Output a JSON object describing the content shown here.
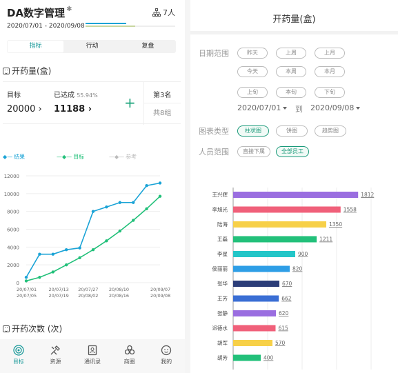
{
  "header": {
    "title": "DA数字管理",
    "people_count": "7人",
    "date_range": "2020/07/01 - 2020/09/08",
    "progress_main": 0.45,
    "progress_sub": 0.55
  },
  "tabs": [
    {
      "label": "指标",
      "active": true
    },
    {
      "label": "行动"
    },
    {
      "label": "复盘"
    }
  ],
  "section1": {
    "title": "开药量(盒)"
  },
  "card": {
    "target_label": "目标",
    "target_value": "20000",
    "achieved_label": "已达成",
    "achieved_pct": "55.94%",
    "achieved_value": "11188",
    "rank": "第3名",
    "group": "共8组"
  },
  "legend": {
    "result": "结果",
    "target": "目标",
    "reference": "参考"
  },
  "colors": {
    "result": "#1aa3d6",
    "target": "#22c07a",
    "reference": "#cccccc",
    "accent": "#1a9a9a"
  },
  "chart_data": [
    {
      "type": "line",
      "y_ticks": [
        "12000",
        "10000",
        "8000",
        "6000",
        "4000",
        "2000",
        "0"
      ],
      "ylim": [
        0,
        12000
      ],
      "x_ticks_top": [
        "20/07/01",
        "20/07/13",
        "20/07/27",
        "20/08/10",
        "20/09/07"
      ],
      "x_ticks_bottom": [
        "20/07/05",
        "20/07/19",
        "20/08/02",
        "20/08/16",
        "20/09/08"
      ],
      "series": [
        {
          "name": "结果",
          "values": [
            600,
            3200,
            3200,
            3700,
            3900,
            8000,
            8500,
            9000,
            9000,
            10900,
            11188
          ]
        },
        {
          "name": "目标",
          "values": [
            200,
            600,
            1200,
            2000,
            2800,
            3700,
            4700,
            5800,
            7000,
            8300,
            9700
          ]
        }
      ]
    },
    {
      "type": "bar",
      "categories": [
        "王兴辉",
        "李旭光",
        "陆海",
        "王磊",
        "李星",
        "侯丽丽",
        "张华",
        "王芳",
        "张静",
        "迟德水",
        "胡军",
        "胡芳"
      ],
      "values": [
        1812,
        1558,
        1350,
        1211,
        900,
        820,
        670,
        662,
        620,
        615,
        570,
        400
      ],
      "colors": [
        "#9a6ee0",
        "#f0607a",
        "#f7d048",
        "#22c07a",
        "#23c6c8",
        "#2e9ee6",
        "#2b3d78",
        "#3a6ed4",
        "#9a6ee0",
        "#f0607a",
        "#f7d048",
        "#22c07a"
      ],
      "xlim": [
        0,
        2000
      ]
    }
  ],
  "section2": {
    "title": "开药次数 (次)"
  },
  "nav": [
    {
      "label": "目标",
      "active": true,
      "icon": "target-icon"
    },
    {
      "label": "资源",
      "icon": "tools-icon"
    },
    {
      "label": "通讯录",
      "icon": "contacts-icon"
    },
    {
      "label": "商圈",
      "icon": "circle-icon"
    },
    {
      "label": "我的",
      "icon": "face-icon"
    }
  ],
  "right": {
    "title": "开药量(盒)",
    "date_label": "日期范围",
    "date_pills": [
      "昨天",
      "上周",
      "上月",
      "今天",
      "本周",
      "本月",
      "上旬",
      "本旬",
      "下旬"
    ],
    "date_start": "2020/07/01",
    "to": "到",
    "date_end": "2020/09/08",
    "chart_label": "图表类型",
    "chart_pills": [
      "柱状图",
      "饼图",
      "趋势图"
    ],
    "people_label": "人员范围",
    "people_pills": [
      "直接下属",
      "全部员工"
    ]
  }
}
